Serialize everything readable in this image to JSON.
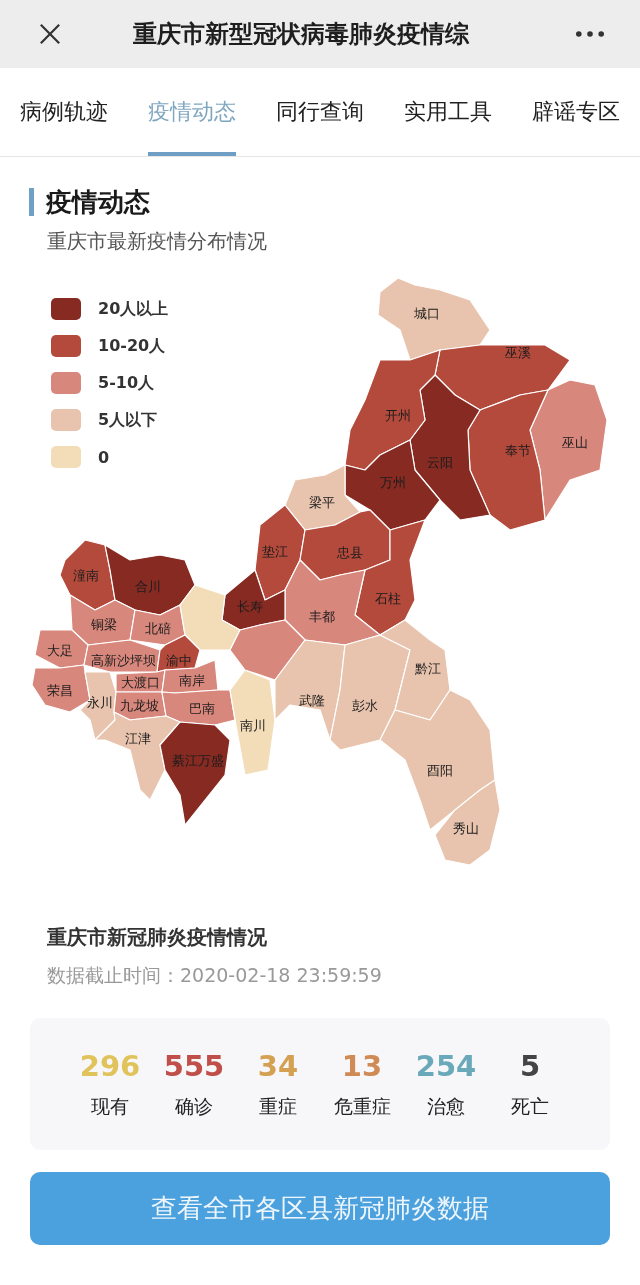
{
  "window": {
    "title": "重庆市新型冠状病毒肺炎疫情综"
  },
  "tabs": [
    {
      "label": "病例轨迹",
      "selected": false
    },
    {
      "label": "疫情动态",
      "selected": true
    },
    {
      "label": "同行查询",
      "selected": false
    },
    {
      "label": "实用工具",
      "selected": false
    },
    {
      "label": "辟谣专区",
      "selected": false
    }
  ],
  "section": {
    "title": "疫情动态",
    "subtitle": "重庆市最新疫情分布情况"
  },
  "map": {
    "legend": [
      {
        "label": "20人以上",
        "color": "#862a22"
      },
      {
        "label": "10-20人",
        "color": "#b34a3c"
      },
      {
        "label": "5-10人",
        "color": "#d8877c"
      },
      {
        "label": "5人以下",
        "color": "#e8c3ad"
      },
      {
        "label": "0",
        "color": "#f3dcb8"
      }
    ],
    "districts": [
      {
        "name": "城口",
        "color": "#e8c3ad"
      },
      {
        "name": "巫溪",
        "color": "#b34a3c"
      },
      {
        "name": "巫山",
        "color": "#d8877c"
      },
      {
        "name": "奉节",
        "color": "#b34a3c"
      },
      {
        "name": "云阳",
        "color": "#862a22"
      },
      {
        "name": "开州",
        "color": "#b34a3c"
      },
      {
        "name": "万州",
        "color": "#862a22"
      },
      {
        "name": "梁平",
        "color": "#e8c3ad"
      },
      {
        "name": "垫江",
        "color": "#b34a3c"
      },
      {
        "name": "忠县",
        "color": "#b34a3c"
      },
      {
        "name": "石柱",
        "color": "#b34a3c"
      },
      {
        "name": "丰都",
        "color": "#d8877c"
      },
      {
        "name": "长寿",
        "color": "#862a22"
      },
      {
        "name": "潼南",
        "color": "#b34a3c"
      },
      {
        "name": "合川",
        "color": "#862a22"
      },
      {
        "name": "铜梁",
        "color": "#d8877c"
      },
      {
        "name": "北碚",
        "color": "#d8877c"
      },
      {
        "color": "#f3dcb8"
      },
      {
        "name": "大足",
        "color": "#d8877c"
      },
      {
        "name": "高新沙坪坝",
        "color": "#d8877c"
      },
      {
        "name": "渝中",
        "color": "#b34a3c"
      },
      {
        "name": "荣昌",
        "color": "#d8877c"
      },
      {
        "name": "永川",
        "color": "#e8c3ad"
      },
      {
        "name": "大渡口",
        "color": "#d8877c"
      },
      {
        "name": "南岸",
        "color": "#d8877c"
      },
      {
        "name": "九龙坡",
        "color": "#d8877c"
      },
      {
        "name": "巴南",
        "color": "#d8877c"
      },
      {
        "name": "南川",
        "color": "#f3dcb8"
      },
      {
        "name": "江津",
        "color": "#e8c3ad"
      },
      {
        "name": "綦江万盛",
        "color": "#862a22"
      },
      {
        "color": "#d8877c"
      },
      {
        "name": "武隆",
        "color": "#e8c3ad"
      },
      {
        "name": "彭水",
        "color": "#e8c3ad"
      },
      {
        "name": "黔江",
        "color": "#e8c3ad"
      },
      {
        "name": "酉阳",
        "color": "#e8c3ad"
      },
      {
        "name": "秀山",
        "color": "#e8c3ad"
      }
    ]
  },
  "summary": {
    "title": "重庆市新冠肺炎疫情情况",
    "updated": "数据截止时间：2020-02-18 23:59:59",
    "stats": [
      {
        "value": "296",
        "label": "现有",
        "color": "#e0c35a"
      },
      {
        "value": "555",
        "label": "确诊",
        "color": "#bf4f48"
      },
      {
        "value": "34",
        "label": "重症",
        "color": "#d4a052"
      },
      {
        "value": "13",
        "label": "危重症",
        "color": "#d08a55"
      },
      {
        "value": "254",
        "label": "治愈",
        "color": "#6aa9b9"
      },
      {
        "value": "5",
        "label": "死亡",
        "color": "#444444"
      }
    ]
  },
  "button": {
    "label": "查看全市各区县新冠肺炎数据"
  }
}
